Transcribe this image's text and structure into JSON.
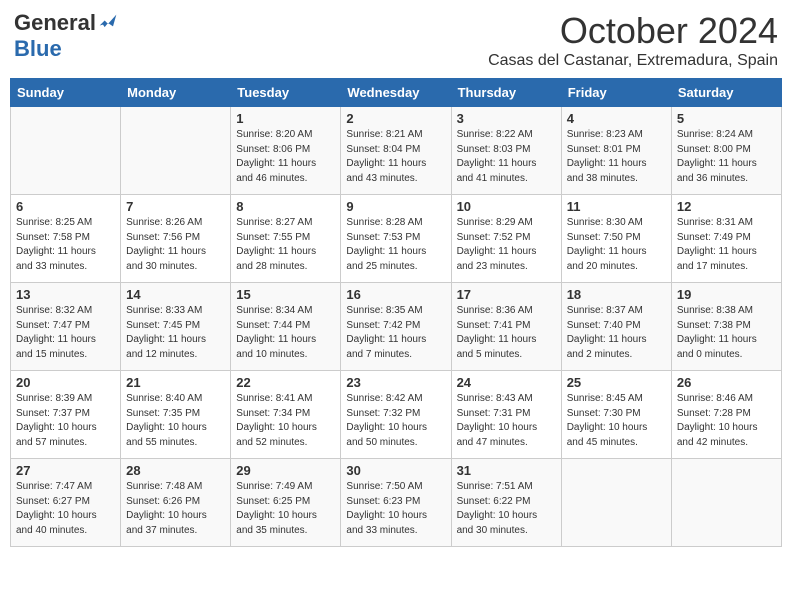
{
  "header": {
    "logo_general": "General",
    "logo_blue": "Blue",
    "month_title": "October 2024",
    "subtitle": "Casas del Castanar, Extremadura, Spain"
  },
  "weekdays": [
    "Sunday",
    "Monday",
    "Tuesday",
    "Wednesday",
    "Thursday",
    "Friday",
    "Saturday"
  ],
  "weeks": [
    [
      {
        "day": "",
        "info": ""
      },
      {
        "day": "",
        "info": ""
      },
      {
        "day": "1",
        "info": "Sunrise: 8:20 AM\nSunset: 8:06 PM\nDaylight: 11 hours\nand 46 minutes."
      },
      {
        "day": "2",
        "info": "Sunrise: 8:21 AM\nSunset: 8:04 PM\nDaylight: 11 hours\nand 43 minutes."
      },
      {
        "day": "3",
        "info": "Sunrise: 8:22 AM\nSunset: 8:03 PM\nDaylight: 11 hours\nand 41 minutes."
      },
      {
        "day": "4",
        "info": "Sunrise: 8:23 AM\nSunset: 8:01 PM\nDaylight: 11 hours\nand 38 minutes."
      },
      {
        "day": "5",
        "info": "Sunrise: 8:24 AM\nSunset: 8:00 PM\nDaylight: 11 hours\nand 36 minutes."
      }
    ],
    [
      {
        "day": "6",
        "info": "Sunrise: 8:25 AM\nSunset: 7:58 PM\nDaylight: 11 hours\nand 33 minutes."
      },
      {
        "day": "7",
        "info": "Sunrise: 8:26 AM\nSunset: 7:56 PM\nDaylight: 11 hours\nand 30 minutes."
      },
      {
        "day": "8",
        "info": "Sunrise: 8:27 AM\nSunset: 7:55 PM\nDaylight: 11 hours\nand 28 minutes."
      },
      {
        "day": "9",
        "info": "Sunrise: 8:28 AM\nSunset: 7:53 PM\nDaylight: 11 hours\nand 25 minutes."
      },
      {
        "day": "10",
        "info": "Sunrise: 8:29 AM\nSunset: 7:52 PM\nDaylight: 11 hours\nand 23 minutes."
      },
      {
        "day": "11",
        "info": "Sunrise: 8:30 AM\nSunset: 7:50 PM\nDaylight: 11 hours\nand 20 minutes."
      },
      {
        "day": "12",
        "info": "Sunrise: 8:31 AM\nSunset: 7:49 PM\nDaylight: 11 hours\nand 17 minutes."
      }
    ],
    [
      {
        "day": "13",
        "info": "Sunrise: 8:32 AM\nSunset: 7:47 PM\nDaylight: 11 hours\nand 15 minutes."
      },
      {
        "day": "14",
        "info": "Sunrise: 8:33 AM\nSunset: 7:45 PM\nDaylight: 11 hours\nand 12 minutes."
      },
      {
        "day": "15",
        "info": "Sunrise: 8:34 AM\nSunset: 7:44 PM\nDaylight: 11 hours\nand 10 minutes."
      },
      {
        "day": "16",
        "info": "Sunrise: 8:35 AM\nSunset: 7:42 PM\nDaylight: 11 hours\nand 7 minutes."
      },
      {
        "day": "17",
        "info": "Sunrise: 8:36 AM\nSunset: 7:41 PM\nDaylight: 11 hours\nand 5 minutes."
      },
      {
        "day": "18",
        "info": "Sunrise: 8:37 AM\nSunset: 7:40 PM\nDaylight: 11 hours\nand 2 minutes."
      },
      {
        "day": "19",
        "info": "Sunrise: 8:38 AM\nSunset: 7:38 PM\nDaylight: 11 hours\nand 0 minutes."
      }
    ],
    [
      {
        "day": "20",
        "info": "Sunrise: 8:39 AM\nSunset: 7:37 PM\nDaylight: 10 hours\nand 57 minutes."
      },
      {
        "day": "21",
        "info": "Sunrise: 8:40 AM\nSunset: 7:35 PM\nDaylight: 10 hours\nand 55 minutes."
      },
      {
        "day": "22",
        "info": "Sunrise: 8:41 AM\nSunset: 7:34 PM\nDaylight: 10 hours\nand 52 minutes."
      },
      {
        "day": "23",
        "info": "Sunrise: 8:42 AM\nSunset: 7:32 PM\nDaylight: 10 hours\nand 50 minutes."
      },
      {
        "day": "24",
        "info": "Sunrise: 8:43 AM\nSunset: 7:31 PM\nDaylight: 10 hours\nand 47 minutes."
      },
      {
        "day": "25",
        "info": "Sunrise: 8:45 AM\nSunset: 7:30 PM\nDaylight: 10 hours\nand 45 minutes."
      },
      {
        "day": "26",
        "info": "Sunrise: 8:46 AM\nSunset: 7:28 PM\nDaylight: 10 hours\nand 42 minutes."
      }
    ],
    [
      {
        "day": "27",
        "info": "Sunrise: 7:47 AM\nSunset: 6:27 PM\nDaylight: 10 hours\nand 40 minutes."
      },
      {
        "day": "28",
        "info": "Sunrise: 7:48 AM\nSunset: 6:26 PM\nDaylight: 10 hours\nand 37 minutes."
      },
      {
        "day": "29",
        "info": "Sunrise: 7:49 AM\nSunset: 6:25 PM\nDaylight: 10 hours\nand 35 minutes."
      },
      {
        "day": "30",
        "info": "Sunrise: 7:50 AM\nSunset: 6:23 PM\nDaylight: 10 hours\nand 33 minutes."
      },
      {
        "day": "31",
        "info": "Sunrise: 7:51 AM\nSunset: 6:22 PM\nDaylight: 10 hours\nand 30 minutes."
      },
      {
        "day": "",
        "info": ""
      },
      {
        "day": "",
        "info": ""
      }
    ]
  ]
}
